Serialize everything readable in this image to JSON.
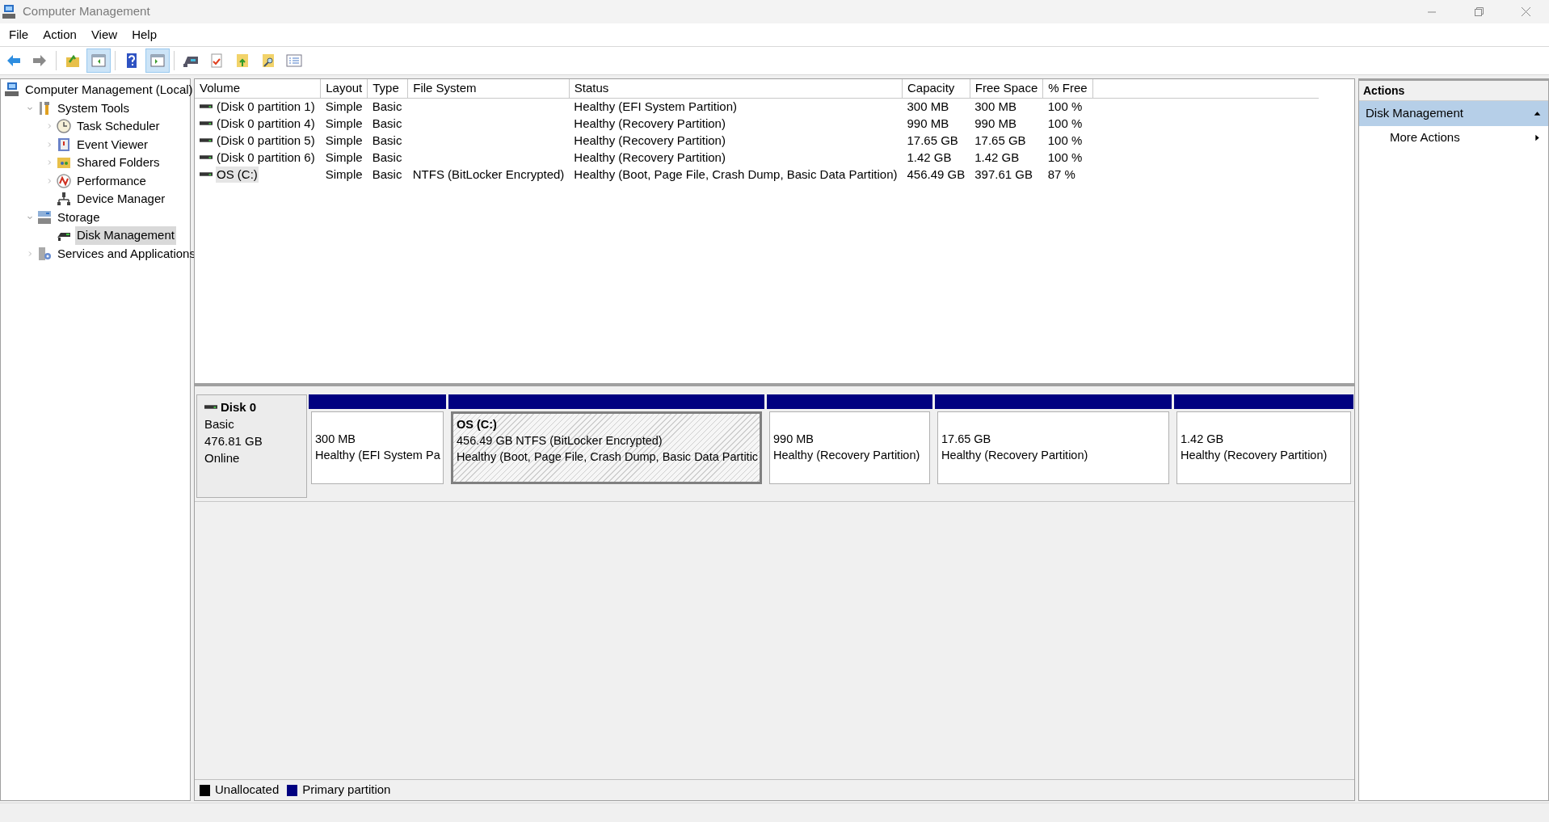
{
  "window": {
    "title": "Computer Management"
  },
  "menu": [
    "File",
    "Action",
    "View",
    "Help"
  ],
  "toolbar": [
    {
      "kind": "back",
      "on": false
    },
    {
      "kind": "forward",
      "on": false
    },
    {
      "kind": "sep"
    },
    {
      "kind": "up",
      "on": false
    },
    {
      "kind": "tree",
      "on": true
    },
    {
      "kind": "sep"
    },
    {
      "kind": "help",
      "on": false
    },
    {
      "kind": "actionpane",
      "on": true
    },
    {
      "kind": "sep"
    },
    {
      "kind": "drive",
      "on": false
    },
    {
      "kind": "check",
      "on": false
    },
    {
      "kind": "folderup",
      "on": false
    },
    {
      "kind": "foldersearch",
      "on": false
    },
    {
      "kind": "list",
      "on": false
    }
  ],
  "tree": [
    {
      "label": "Computer Management (Local)",
      "kind": "computer",
      "selected": false,
      "children": [
        {
          "label": "System Tools",
          "kind": "tools",
          "selected": false,
          "expanded": true,
          "children": [
            {
              "label": "Task Scheduler",
              "kind": "clock",
              "selected": false,
              "expanded": false
            },
            {
              "label": "Event Viewer",
              "kind": "event",
              "selected": false,
              "expanded": false
            },
            {
              "label": "Shared Folders",
              "kind": "folder",
              "selected": false,
              "expanded": false
            },
            {
              "label": "Performance",
              "kind": "perf",
              "selected": false,
              "expanded": false
            },
            {
              "label": "Device Manager",
              "kind": "device",
              "selected": false
            }
          ]
        },
        {
          "label": "Storage",
          "kind": "storage",
          "selected": false,
          "expanded": true,
          "children": [
            {
              "label": "Disk Management",
              "kind": "disk",
              "selected": true
            }
          ]
        },
        {
          "label": "Services and Applications",
          "kind": "services",
          "selected": false,
          "expanded": false
        }
      ]
    }
  ],
  "volumes": {
    "columns": [
      "Volume",
      "Layout",
      "Type",
      "File System",
      "Status",
      "Capacity",
      "Free Space",
      "% Free"
    ],
    "rows": [
      {
        "cells": [
          "(Disk 0 partition 1)",
          "Simple",
          "Basic",
          "",
          "Healthy (EFI System Partition)",
          "300 MB",
          "300 MB",
          "100 %"
        ],
        "selected": false
      },
      {
        "cells": [
          "(Disk 0 partition 4)",
          "Simple",
          "Basic",
          "",
          "Healthy (Recovery Partition)",
          "990 MB",
          "990 MB",
          "100 %"
        ],
        "selected": false
      },
      {
        "cells": [
          "(Disk 0 partition 5)",
          "Simple",
          "Basic",
          "",
          "Healthy (Recovery Partition)",
          "17.65 GB",
          "17.65 GB",
          "100 %"
        ],
        "selected": false
      },
      {
        "cells": [
          "(Disk 0 partition 6)",
          "Simple",
          "Basic",
          "",
          "Healthy (Recovery Partition)",
          "1.42 GB",
          "1.42 GB",
          "100 %"
        ],
        "selected": false
      },
      {
        "cells": [
          "OS (C:)",
          "Simple",
          "Basic",
          "NTFS (BitLocker Encrypted)",
          "Healthy (Boot, Page File, Crash Dump, Basic Data Partition)",
          "456.49 GB",
          "397.61 GB",
          "87 %"
        ],
        "selected": true
      }
    ]
  },
  "disk": {
    "name": "Disk 0",
    "type": "Basic",
    "size": "476.81 GB",
    "state": "Online",
    "partitions": [
      {
        "size": "300 MB",
        "status": "Healthy (EFI System Pa",
        "selected": false
      },
      {
        "name": "OS  (C:)",
        "size": "456.49 GB NTFS (BitLocker Encrypted)",
        "status": "Healthy (Boot, Page File, Crash Dump, Basic Data Partitic",
        "selected": true
      },
      {
        "size": "990 MB",
        "status": "Healthy (Recovery Partition)",
        "selected": false
      },
      {
        "size": "17.65 GB",
        "status": "Healthy (Recovery Partition)",
        "selected": false
      },
      {
        "size": "1.42 GB",
        "status": "Healthy (Recovery Partition)",
        "selected": false
      }
    ]
  },
  "legend": [
    {
      "label": "Unallocated",
      "color": "#000000"
    },
    {
      "label": "Primary partition",
      "color": "#000080"
    }
  ],
  "actions": {
    "title": "Actions",
    "section": {
      "label": "Disk Management",
      "expanded": true
    },
    "items": [
      "More Actions"
    ]
  }
}
